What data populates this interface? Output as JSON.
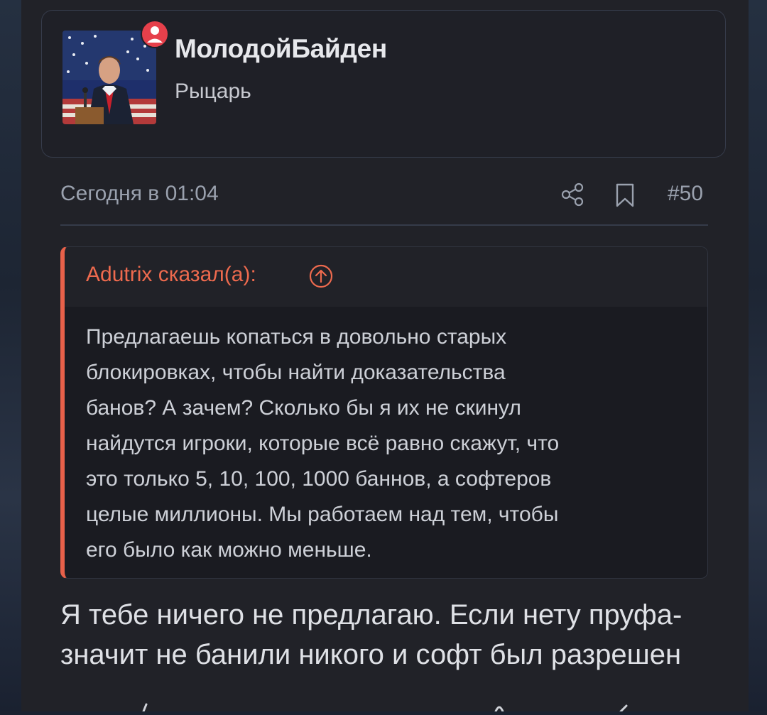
{
  "user": {
    "name": "МолодойБайден",
    "title": "Рыцарь"
  },
  "post": {
    "date": "Сегодня в 01:04",
    "number": "#50",
    "body_lines": [
      "Я тебе ничего не предлагаю. Если нету пруфа-",
      "значит не банили никого и софт был разрешен"
    ]
  },
  "quote": {
    "author_label": "Adutrix сказал(а):",
    "lines": [
      "Предлагаешь копаться в довольно старых",
      "блокировках, чтобы найти доказательства",
      "банов? А зачем? Сколько бы я их не скинул",
      "найдутся игроки, которые всё равно скажут, что",
      "это только 5, 10, 100, 1000 баннов, а софтеров",
      "целые миллионы. Мы работаем над тем, чтобы",
      "его было как можно меньше."
    ]
  },
  "icons": {
    "status": "user-status-icon",
    "share": "share-icon",
    "bookmark": "bookmark-icon",
    "jump": "arrow-up-circle-icon"
  },
  "colors": {
    "accent": "#e8614a",
    "status_red": "#e6404b",
    "panel": "#212228",
    "quote_bg": "#1a1b21"
  }
}
